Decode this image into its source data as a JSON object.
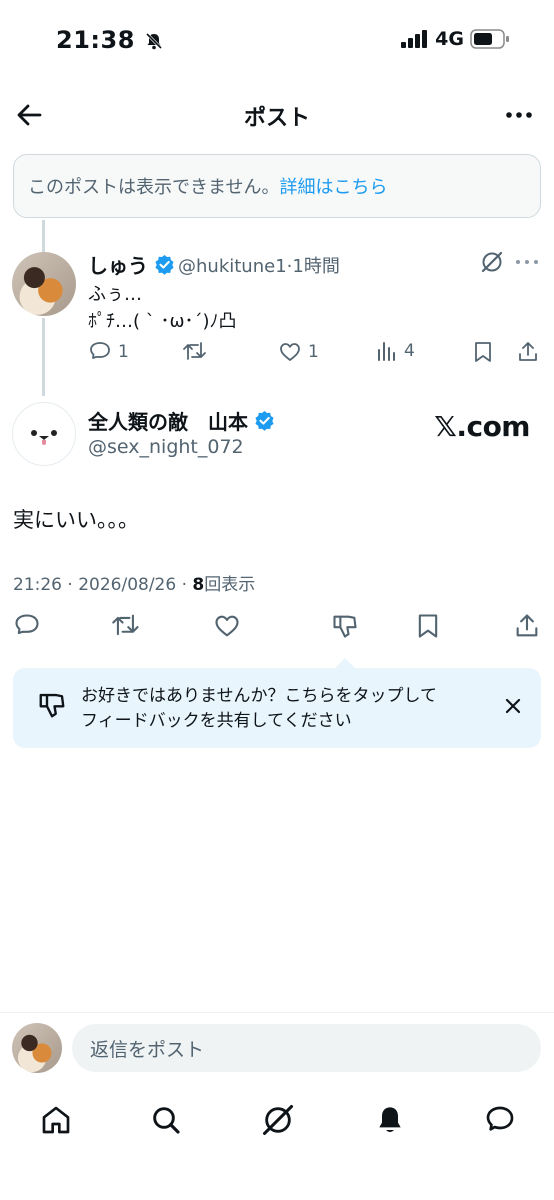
{
  "status_bar": {
    "time": "21:38",
    "network": "4G"
  },
  "header": {
    "title": "ポスト"
  },
  "notice": {
    "text": "このポストは表示できません。",
    "link": "詳細はこちら"
  },
  "parent_post": {
    "name": "しゅう",
    "handle": "@hukitune1",
    "time": "1時間",
    "line1": "ふぅ…",
    "line2": "ﾎﾟﾁ…( ` ･ω･´)ﾉ凸",
    "replies": "1",
    "likes": "1",
    "views": "4"
  },
  "main_post": {
    "name": "全人類の敵　山本",
    "handle": "@sex_night_072",
    "watermark": "𝕏.com",
    "text": "実にいい。。。",
    "timestamp": "21:26 · 2026/08/26 · ",
    "view_count": "8",
    "view_label": "回表示"
  },
  "feedback": {
    "line1": "お好きではありませんか？こちらをタップして",
    "line2": "フィードバックを共有してください"
  },
  "reply_bar": {
    "placeholder": "返信をポスト"
  },
  "colors": {
    "accent": "#1d9bf0",
    "text": "#0f1419",
    "muted": "#536471"
  }
}
